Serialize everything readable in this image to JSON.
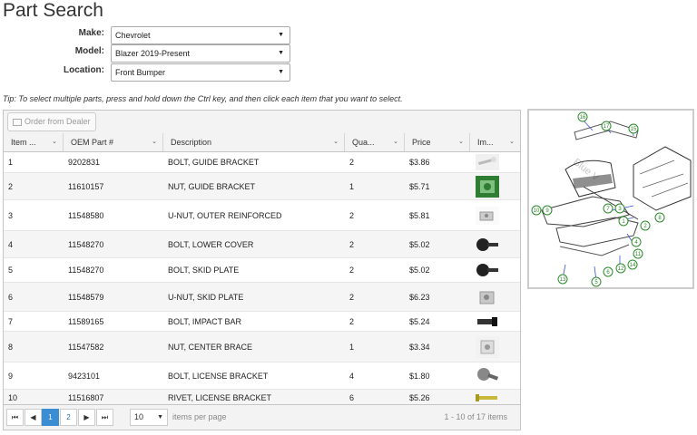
{
  "page": {
    "title": "Part Search"
  },
  "filters": {
    "make": {
      "label": "Make:",
      "value": "Chevrolet"
    },
    "model": {
      "label": "Model:",
      "value": "Blazer 2019-Present"
    },
    "location": {
      "label": "Location:",
      "value": "Front Bumper"
    }
  },
  "tip": "Tip: To select multiple parts, press and hold down the Ctrl key, and then click each item that you want to select.",
  "toolbar": {
    "order_label": "Order from Dealer"
  },
  "table": {
    "columns": [
      "Item ...",
      "OEM Part #",
      "Description",
      "Qua...",
      "Price",
      "Im..."
    ],
    "rows": [
      {
        "item": "1",
        "oem": "9202831",
        "desc": "BOLT, GUIDE BRACKET",
        "qty": "2",
        "price": "$3.86"
      },
      {
        "item": "2",
        "oem": "11610157",
        "desc": "NUT, GUIDE BRACKET",
        "qty": "1",
        "price": "$5.71"
      },
      {
        "item": "3",
        "oem": "11548580",
        "desc": "U-NUT, OUTER REINFORCED",
        "qty": "2",
        "price": "$5.81"
      },
      {
        "item": "4",
        "oem": "11548270",
        "desc": "BOLT, LOWER COVER",
        "qty": "2",
        "price": "$5.02"
      },
      {
        "item": "5",
        "oem": "11548270",
        "desc": "BOLT, SKID PLATE",
        "qty": "2",
        "price": "$5.02"
      },
      {
        "item": "6",
        "oem": "11548579",
        "desc": "U-NUT, SKID PLATE",
        "qty": "2",
        "price": "$6.23"
      },
      {
        "item": "7",
        "oem": "11589165",
        "desc": "BOLT, IMPACT BAR",
        "qty": "2",
        "price": "$5.24"
      },
      {
        "item": "8",
        "oem": "11547582",
        "desc": "NUT, CENTER BRACE",
        "qty": "1",
        "price": "$3.34"
      },
      {
        "item": "9",
        "oem": "9423101",
        "desc": "BOLT, LICENSE BRACKET",
        "qty": "4",
        "price": "$1.80"
      },
      {
        "item": "10",
        "oem": "11516807",
        "desc": "RIVET, LICENSE BRACKET",
        "qty": "6",
        "price": "$5.26"
      }
    ]
  },
  "pager": {
    "first_icon": "first-page-icon",
    "prev_icon": "prev-page-icon",
    "next_icon": "next-page-icon",
    "last_icon": "last-page-icon",
    "pages": [
      "1",
      "2"
    ],
    "current_page": "1",
    "page_size": "10",
    "page_size_label": "items per page",
    "info": "1 - 10 of 17 items"
  },
  "diagram": {
    "watermark": "Blue V",
    "callouts": [
      "16",
      "17",
      "15",
      "10",
      "9",
      "7",
      "3",
      "8",
      "1",
      "2",
      "4",
      "6",
      "12",
      "14",
      "13",
      "5",
      "11"
    ],
    "accent_color": "#2a8a2a",
    "line_color": "#3355cc"
  },
  "colors": {
    "accent": "#3b8ed4",
    "link": "#2d6fb0"
  }
}
